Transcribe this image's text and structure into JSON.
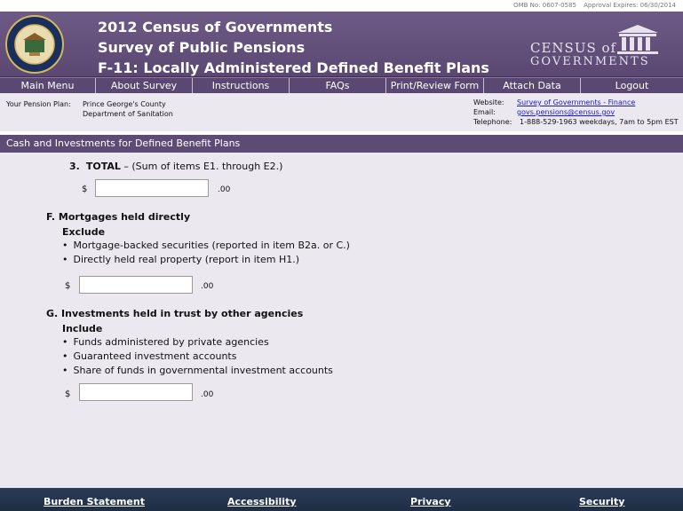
{
  "omb": {
    "number": "OMB No:  0607-0585",
    "expires": "Approval Expires:  06/30/2014"
  },
  "banner": {
    "title1": "2012 Census of Governments",
    "title2": "Survey of Public Pensions",
    "title3": "F-11:  Locally Administered Defined Benefit Plans",
    "logo_line1": "CENSUS of",
    "logo_line2": "GOVERNMENTS",
    "seal_icon": "department-of-commerce-seal"
  },
  "nav": [
    "Main Menu",
    "About Survey",
    "Instructions",
    "FAQs",
    "Print/Review Form",
    "Attach Data",
    "Logout"
  ],
  "plan": {
    "label": "Your Pension Plan:",
    "line1": "Prince George's County",
    "line2": "Department of Sanitation"
  },
  "contact": {
    "website_label": "Website:",
    "website_link": "Survey of Governments - Finance",
    "email_label": "Email:",
    "email_link": "govs.pensions@census.gov",
    "telephone_label": "Telephone:",
    "telephone_value": "1-888-529-1963  weekdays, 7am to 5pm EST"
  },
  "section_title": "Cash and Investments for Defined Benefit Plans",
  "item3": {
    "number": "3.",
    "label": "TOTAL",
    "desc": " – (Sum of items E1. through E2.)",
    "value": ""
  },
  "itemF": {
    "heading": "F.  Mortgages held directly",
    "sub": "Exclude",
    "bullets": [
      "Mortgage-backed securities (reported in item B2a. or C.)",
      "Directly held real property (report in item H1.)"
    ],
    "value": ""
  },
  "itemG": {
    "heading": "G.  Investments held in trust by other agencies",
    "sub": "Include",
    "bullets": [
      "Funds administered by private agencies",
      "Guaranteed investment accounts",
      "Share of funds in governmental investment accounts"
    ],
    "value": ""
  },
  "currency": "$",
  "cents": ".00",
  "footer": [
    "Burden Statement",
    "Accessibility",
    "Privacy",
    "Security"
  ]
}
